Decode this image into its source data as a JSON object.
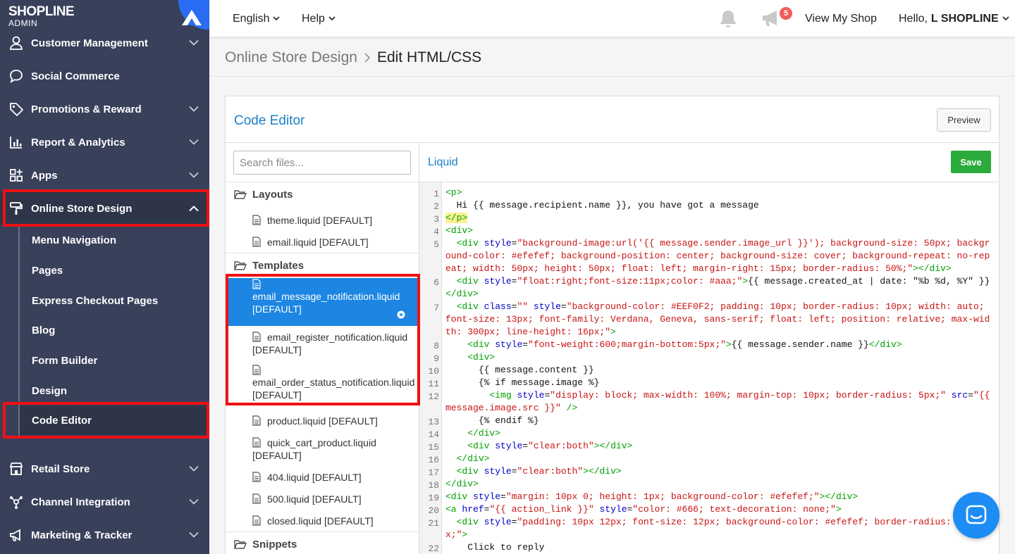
{
  "brand": {
    "name": "SHOPLINE",
    "sub": "ADMIN"
  },
  "topbar": {
    "language": "English",
    "help": "Help",
    "notification_count": "5",
    "view_shop": "View My Shop",
    "greeting_prefix": "Hello,",
    "user_name": "L SHOPLINE"
  },
  "sidebar": {
    "items": [
      {
        "label": "Customer Management",
        "icon": "user-icon"
      },
      {
        "label": "Social Commerce",
        "icon": "chat-bubble-icon"
      },
      {
        "label": "Promotions & Reward",
        "icon": "tag-icon"
      },
      {
        "label": "Report & Analytics",
        "icon": "bar-chart-icon"
      },
      {
        "label": "Apps",
        "icon": "apps-grid-icon"
      },
      {
        "label": "Online Store Design",
        "icon": "paint-roller-icon"
      },
      {
        "label": "Retail Store",
        "icon": "store-icon"
      },
      {
        "label": "Channel Integration",
        "icon": "network-icon"
      },
      {
        "label": "Marketing & Tracker",
        "icon": "megaphone-icon"
      }
    ],
    "sub_items": [
      "Menu Navigation",
      "Pages",
      "Express Checkout Pages",
      "Blog",
      "Form Builder",
      "Design",
      "Code Editor"
    ]
  },
  "breadcrumb": {
    "parent": "Online Store Design",
    "current": "Edit HTML/CSS"
  },
  "panel": {
    "title": "Code Editor",
    "preview_label": "Preview"
  },
  "tree": {
    "search_placeholder": "Search files...",
    "groups": {
      "layouts": "Layouts",
      "templates": "Templates",
      "snippets": "Snippets"
    },
    "layout_files": [
      "theme.liquid [DEFAULT]",
      "email.liquid [DEFAULT]"
    ],
    "template_files": [
      {
        "name": "email_message_notification.liquid",
        "tag": "[DEFAULT]"
      },
      {
        "name": "email_register_notification.liquid",
        "tag": "[DEFAULT]"
      },
      {
        "name": "email_order_status_notification.liquid",
        "tag": "[DEFAULT]"
      },
      {
        "name": "product.liquid [DEFAULT]"
      },
      {
        "name": "quick_cart_product.liquid",
        "tag": "[DEFAULT]"
      },
      {
        "name": "404.liquid [DEFAULT]"
      },
      {
        "name": "500.liquid [DEFAULT]"
      },
      {
        "name": "closed.liquid [DEFAULT]"
      }
    ]
  },
  "editor": {
    "language": "Liquid",
    "save_label": "Save",
    "line_numbers": [
      "1",
      "2",
      "3",
      "4",
      "5",
      "6",
      "7",
      "8",
      "9",
      "10",
      "11",
      "12",
      "13",
      "14",
      "15",
      "16",
      "17",
      "18",
      "19",
      "20",
      "21",
      "22"
    ]
  },
  "colors": {
    "sidebar_bg": "#38405a",
    "accent_blue": "#1b80c8",
    "selected_file": "#1c86e2",
    "save_green": "#2bab3b",
    "highlight_red": "#ee1111"
  }
}
